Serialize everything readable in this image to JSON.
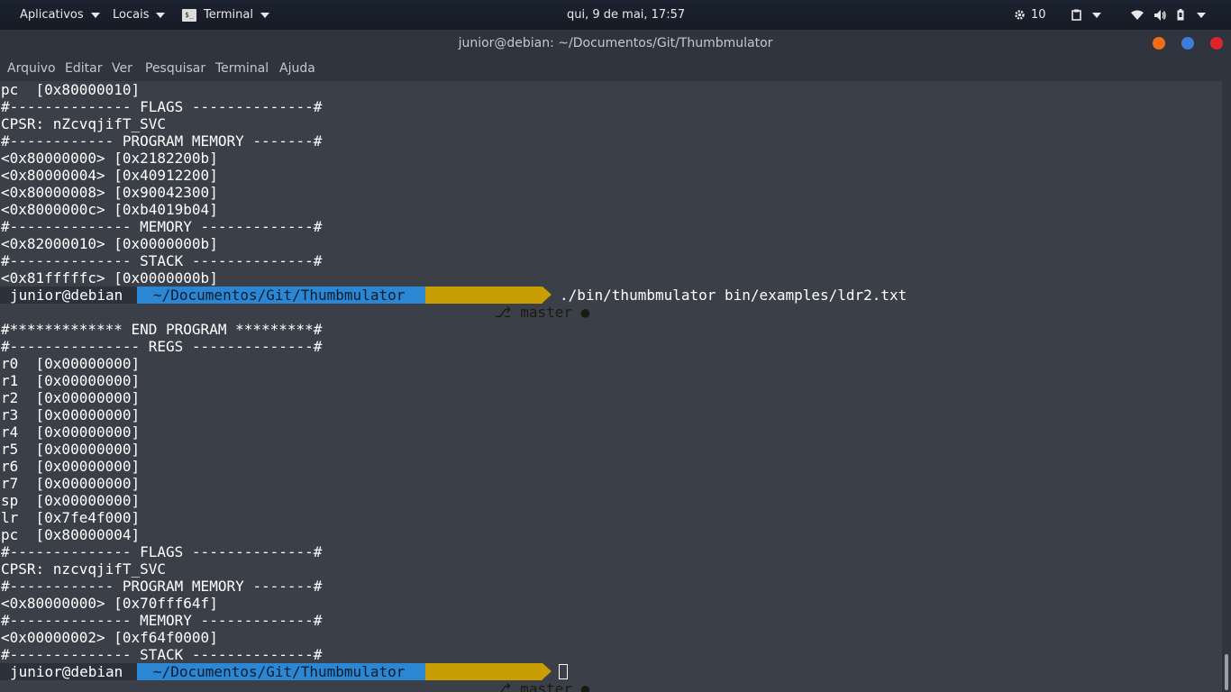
{
  "topbar": {
    "applications": "Aplicativos",
    "places": "Locais",
    "active_app": "Terminal",
    "clock": "qui,  9 de mai, 17:57",
    "counter": "10"
  },
  "window": {
    "title": "junior@debian: ~/Documentos/Git/Thumbmulator",
    "button_colors": {
      "minimize": "#f46c15",
      "maximize": "#3b7ddd",
      "close": "#e0222a"
    }
  },
  "menu": [
    "Arquivo",
    "Editar",
    "Ver",
    "Pesquisar",
    "Terminal",
    "Ajuda"
  ],
  "terminal": {
    "lines_before": [
      "pc  [0x80000010]",
      "#-------------- FLAGS --------------#",
      "CPSR: nZcvqjifT_SVC",
      "#------------ PROGRAM MEMORY -------#",
      "<0x80000000> [0x2182200b]",
      "<0x80000004> [0x40912200]",
      "<0x80000008> [0x90042300]",
      "<0x8000000c> [0xb4019b04]",
      "#-------------- MEMORY -------------#",
      "<0x82000010> [0x0000000b]",
      "#-------------- STACK --------------#",
      "<0x81fffffc> [0x0000000b]"
    ],
    "prompt1": {
      "user": "junior@debian",
      "dir": "~/Documentos/Git/Thumbmulator",
      "branch": "master ●",
      "branch_icon": "⎇",
      "command": "./bin/thumbmulator bin/examples/ldr2.txt"
    },
    "lines_after": [
      "",
      "#************* END PROGRAM *********#",
      "#--------------- REGS --------------#",
      "r0  [0x00000000]",
      "r1  [0x00000000]",
      "r2  [0x00000000]",
      "r3  [0x00000000]",
      "r4  [0x00000000]",
      "r5  [0x00000000]",
      "r6  [0x00000000]",
      "r7  [0x00000000]",
      "sp  [0x00000000]",
      "lr  [0x7fe4f000]",
      "pc  [0x80000004]",
      "#-------------- FLAGS --------------#",
      "CPSR: nzcvqjifT_SVC",
      "#------------ PROGRAM MEMORY -------#",
      "<0x80000000> [0x70fff64f]",
      "#-------------- MEMORY -------------#",
      "<0x00000002> [0xf64f0000]",
      "#-------------- STACK --------------#"
    ],
    "prompt2": {
      "user": "junior@debian",
      "dir": "~/Documentos/Git/Thumbmulator",
      "branch": "master ●",
      "branch_icon": "⎇"
    }
  },
  "colors": {
    "terminal_bg": "#3b4048",
    "segment_user_bg": "#2c323c",
    "segment_dir_bg": "#2b86d4",
    "segment_git_bg": "#c99d04"
  }
}
